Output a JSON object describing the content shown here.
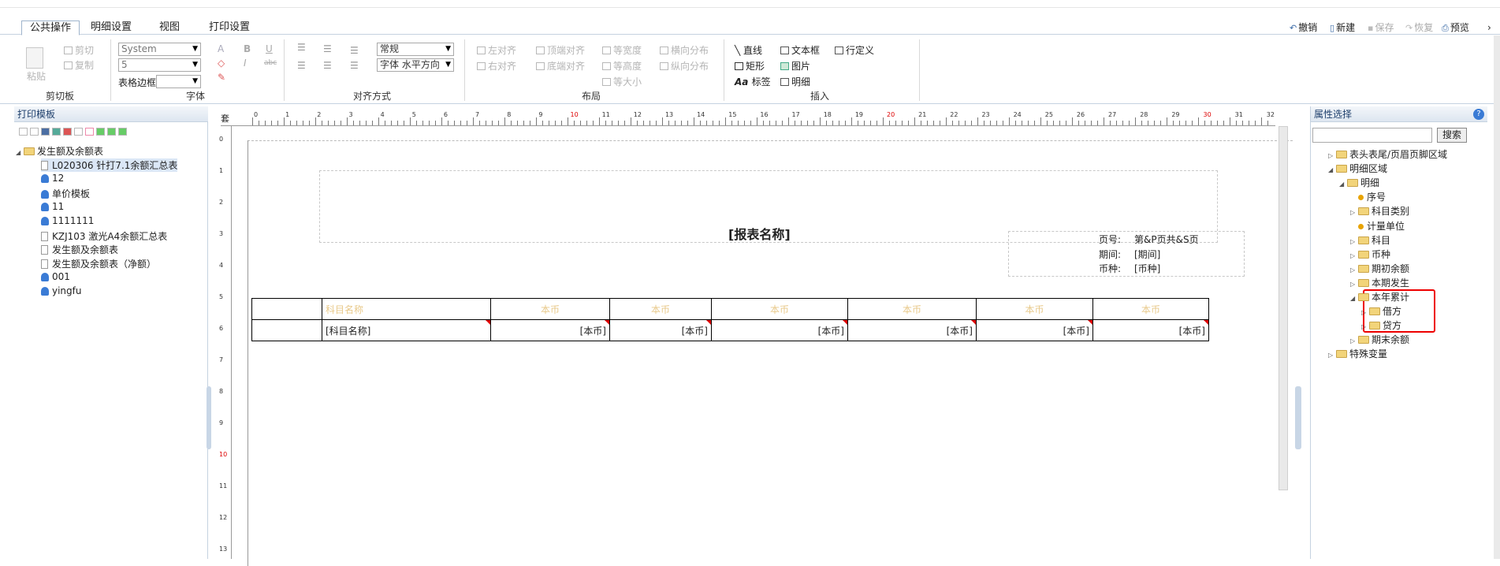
{
  "tabs": [
    "公共操作",
    "明细设置",
    "视图",
    "打印设置"
  ],
  "top_actions": [
    {
      "label": "撤销",
      "enabled": true
    },
    {
      "label": "新建",
      "enabled": true
    },
    {
      "label": "保存",
      "enabled": false
    },
    {
      "label": "恢复",
      "enabled": false
    },
    {
      "label": "预览",
      "enabled": true
    }
  ],
  "ribbon": {
    "clipboard": {
      "paste": "粘贴",
      "cut": "剪切",
      "copy": "复制",
      "label": "剪切板"
    },
    "font": {
      "family": "System",
      "size": "5",
      "table_border": "表格边框",
      "bold": "B",
      "italic": "I",
      "underline": "U",
      "strike": "abc",
      "color_a": "A",
      "label": "字体"
    },
    "align": {
      "style": "常规",
      "hstyle": "字体 水平方向",
      "label": "对齐方式"
    },
    "layout": {
      "align_left": "左对齐",
      "align_top": "顶端对齐",
      "same_width": "等宽度",
      "h_distribute": "横向分布",
      "align_right": "右对齐",
      "align_bottom": "底端对齐",
      "same_height": "等高度",
      "v_distribute": "纵向分布",
      "same_size": "等大小",
      "label": "布局"
    },
    "insert": {
      "line": "直线",
      "textbox": "文本框",
      "custom": "行定义",
      "rect": "矩形",
      "picture": "图片",
      "tag": "标签",
      "detail": "明细",
      "label": "插入"
    }
  },
  "left_panel": {
    "title": "打印模板",
    "root": "发生额及余额表",
    "items": [
      {
        "label": "L020306 针打7.1余额汇总表",
        "kind": "doc",
        "selected": true
      },
      {
        "label": "12",
        "kind": "user"
      },
      {
        "label": "单价模板",
        "kind": "user"
      },
      {
        "label": "11",
        "kind": "user"
      },
      {
        "label": "1111111",
        "kind": "user"
      },
      {
        "label": "KZJ103 激光A4余额汇总表",
        "kind": "doc"
      },
      {
        "label": "发生额及余额表",
        "kind": "doc"
      },
      {
        "label": "发生额及余额表（净额）",
        "kind": "doc"
      },
      {
        "label": "001",
        "kind": "user"
      },
      {
        "label": "yingfu",
        "kind": "user"
      }
    ]
  },
  "ruler": {
    "corner": "套",
    "top_marks": [
      "0",
      "1",
      "2",
      "3",
      "4",
      "5",
      "6",
      "7",
      "8",
      "9",
      "10",
      "11",
      "12",
      "13",
      "14",
      "15",
      "16",
      "17",
      "18",
      "19",
      "20",
      "21",
      "22",
      "23",
      "24",
      "25",
      "26",
      "27",
      "28",
      "29",
      "30",
      "31",
      "32"
    ],
    "left_marks": [
      "0",
      "1",
      "2",
      "3",
      "4",
      "5",
      "6",
      "7",
      "8",
      "9",
      "10",
      "11",
      "12",
      "13"
    ]
  },
  "report": {
    "title": "[报表名称]",
    "page_label": "页号:",
    "page_value": "第&P页共&S页",
    "period_label": "期间:",
    "period_value": "[期间]",
    "currency_label": "币种:",
    "currency_value": "[币种]",
    "header_cells": [
      "",
      "科目名称",
      "本币",
      "本币",
      "本币",
      "本币",
      "本币",
      "本币"
    ],
    "detail_cells": [
      "",
      "[科目名称]",
      "[本币]",
      "[本币]",
      "[本币]",
      "[本币]",
      "[本币]",
      "[本币]"
    ]
  },
  "right_panel": {
    "title": "属性选择",
    "search_button": "搜索",
    "search_placeholder": "",
    "tree": [
      {
        "label": "表头表尾/页眉页脚区域",
        "kind": "folder",
        "depth": 0,
        "expanded": false
      },
      {
        "label": "明细区域",
        "kind": "folder",
        "depth": 0,
        "expanded": true
      },
      {
        "label": "明细",
        "kind": "folder",
        "depth": 1,
        "expanded": true
      },
      {
        "label": "序号",
        "kind": "field",
        "depth": 2
      },
      {
        "label": "科目类别",
        "kind": "folder",
        "depth": 2,
        "expanded": false
      },
      {
        "label": "计量单位",
        "kind": "field",
        "depth": 2
      },
      {
        "label": "科目",
        "kind": "folder",
        "depth": 2,
        "expanded": false
      },
      {
        "label": "币种",
        "kind": "folder",
        "depth": 2,
        "expanded": false
      },
      {
        "label": "期初余额",
        "kind": "folder",
        "depth": 2,
        "expanded": false
      },
      {
        "label": "本期发生",
        "kind": "folder",
        "depth": 2,
        "expanded": false
      },
      {
        "label": "本年累计",
        "kind": "folder",
        "depth": 2,
        "expanded": true
      },
      {
        "label": "借方",
        "kind": "folder",
        "depth": 3,
        "expanded": false
      },
      {
        "label": "贷方",
        "kind": "folder",
        "depth": 3,
        "expanded": false
      },
      {
        "label": "期末余额",
        "kind": "folder",
        "depth": 2,
        "expanded": false
      },
      {
        "label": "特殊变量",
        "kind": "folder",
        "depth": 0,
        "expanded": false
      }
    ]
  }
}
